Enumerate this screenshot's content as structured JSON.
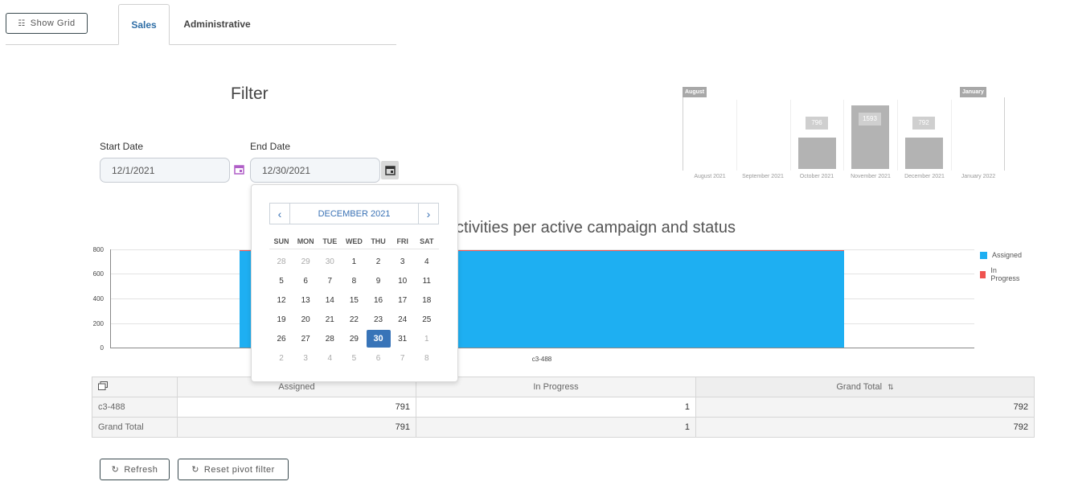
{
  "toolbar": {
    "show_grid_label": "Show Grid"
  },
  "tabs": [
    {
      "label": "Sales",
      "active": true
    },
    {
      "label": "Administrative",
      "active": false
    }
  ],
  "filter": {
    "title": "Filter",
    "start_label": "Start Date",
    "start_value": "12/1/2021",
    "end_label": "End Date",
    "end_value": "12/30/2021"
  },
  "calendar": {
    "title": "DECEMBER 2021",
    "prev": "‹",
    "next": "›",
    "days_of_week": [
      "SUN",
      "MON",
      "TUE",
      "WED",
      "THU",
      "FRI",
      "SAT"
    ],
    "weeks": [
      [
        "28",
        "29",
        "30",
        "1",
        "2",
        "3",
        "4"
      ],
      [
        "5",
        "6",
        "7",
        "8",
        "9",
        "10",
        "11"
      ],
      [
        "12",
        "13",
        "14",
        "15",
        "16",
        "17",
        "18"
      ],
      [
        "19",
        "20",
        "21",
        "22",
        "23",
        "24",
        "25"
      ],
      [
        "26",
        "27",
        "28",
        "29",
        "30",
        "31",
        "1"
      ],
      [
        "2",
        "3",
        "4",
        "5",
        "6",
        "7",
        "8"
      ]
    ],
    "selected": "30"
  },
  "mini_chart": {
    "start_tag": "August 2021",
    "end_tag": "January 2022",
    "months": [
      "August 2021",
      "September 2021",
      "October 2021",
      "November 2021",
      "December 2021",
      "January 2022"
    ],
    "values": [
      null,
      null,
      796,
      1593,
      792,
      null
    ],
    "bar_labels": [
      "",
      "",
      "796",
      "1593",
      "792",
      ""
    ],
    "color": "#b3b3b3"
  },
  "chart_data": {
    "type": "bar",
    "title": "ctivities per active campaign and status",
    "categories": [
      "c3-488"
    ],
    "series": [
      {
        "name": "Assigned",
        "values": [
          791
        ],
        "color": "#1eaff2"
      },
      {
        "name": "In Progress",
        "values": [
          1
        ],
        "color": "#ef5350"
      }
    ],
    "y_ticks": [
      "800",
      "600",
      "400",
      "200",
      "0"
    ],
    "ylim": [
      0,
      800
    ],
    "legend_position": "right",
    "grid": true
  },
  "pivot": {
    "corner_icon": "pivot-icon",
    "columns": [
      "Assigned",
      "In Progress",
      "Grand Total"
    ],
    "sort_icon": "⇅",
    "rows": [
      {
        "label": "c3-488",
        "values": [
          "791",
          "1",
          "792"
        ]
      },
      {
        "label": "Grand Total",
        "values": [
          "791",
          "1",
          "792"
        ]
      }
    ]
  },
  "actions": {
    "refresh_label": "Refresh",
    "reset_label": "Reset pivot filter"
  }
}
